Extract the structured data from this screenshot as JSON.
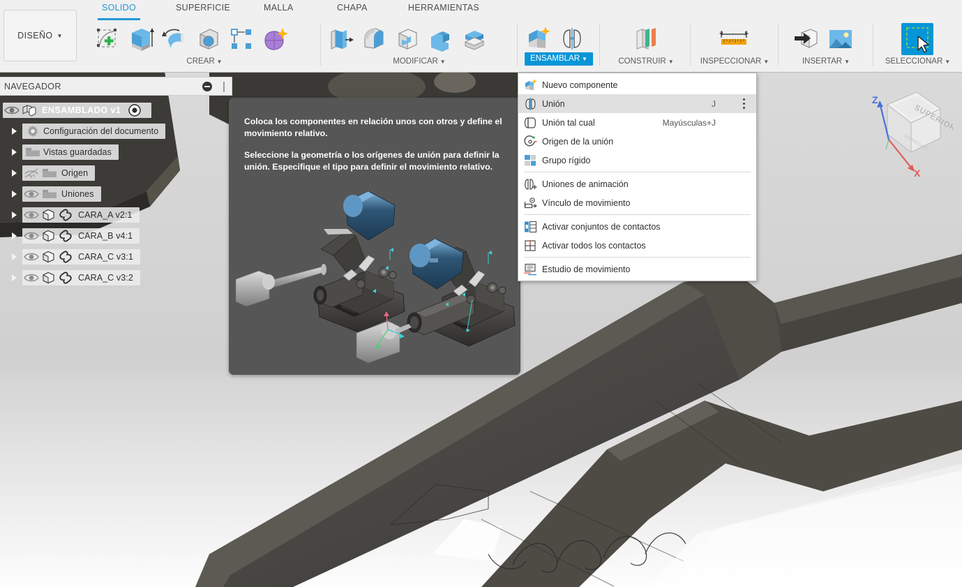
{
  "app": {
    "workspace_label": "DISEÑO",
    "caret": "▼"
  },
  "tabs": [
    {
      "label": "SOLIDO",
      "active": true
    },
    {
      "label": "SUPERFICIE",
      "active": false
    },
    {
      "label": "MALLA",
      "active": false
    },
    {
      "label": "CHAPA",
      "active": false
    },
    {
      "label": "HERRAMIENTAS",
      "active": false
    }
  ],
  "ribbon_groups": [
    {
      "label": "CREAR",
      "highlighted": false
    },
    {
      "label": "MODIFICAR",
      "highlighted": false
    },
    {
      "label": "ENSAMBLAR",
      "highlighted": true
    },
    {
      "label": "CONSTRUIR",
      "highlighted": false
    },
    {
      "label": "INSPECCIONAR",
      "highlighted": false
    },
    {
      "label": "INSERTAR",
      "highlighted": false
    },
    {
      "label": "SELECCIONAR",
      "highlighted": false
    }
  ],
  "navigator": {
    "title": "NAVEGADOR",
    "collapse_icon": "minus-circle-icon",
    "items": [
      {
        "label": "ENSAMBLADO v1",
        "selected": true,
        "arrow": false,
        "eye": "eye-visible-icon",
        "icon": "assembly-icon",
        "radio": true
      },
      {
        "label": "Configuración del documento",
        "selected": false,
        "arrow": true,
        "eye": "none",
        "icon": "gear-icon"
      },
      {
        "label": "Vistas guardadas",
        "selected": false,
        "arrow": true,
        "eye": "none",
        "icon": "folder-icon"
      },
      {
        "label": "Origen",
        "selected": false,
        "arrow": true,
        "eye": "eye-hidden-icon",
        "icon": "folder-icon"
      },
      {
        "label": "Uniones",
        "selected": false,
        "arrow": true,
        "eye": "eye-visible-icon",
        "icon": "folder-icon"
      },
      {
        "label": "CARA_A v2:1",
        "selected": false,
        "arrow": true,
        "eye": "eye-visible-icon",
        "icon": "component-icon",
        "link": true
      },
      {
        "label": "CARA_B v4:1",
        "selected": false,
        "arrow": true,
        "eye": "eye-visible-icon",
        "icon": "component-icon",
        "link": true
      },
      {
        "label": "CARA_C v3:1",
        "selected": false,
        "arrow": true,
        "eye": "eye-visible-icon",
        "icon": "component-icon",
        "link": true
      },
      {
        "label": "CARA_C v3:2",
        "selected": false,
        "arrow": true,
        "eye": "eye-visible-icon",
        "icon": "component-icon",
        "link": true
      }
    ]
  },
  "menu": {
    "owner": "ENSAMBLAR",
    "items": [
      {
        "type": "item",
        "label": "Nuevo componente",
        "shortcut": "",
        "icon": "new-component-icon",
        "highlighted": false,
        "overflow": false
      },
      {
        "type": "item",
        "label": "Unión",
        "shortcut": "J",
        "icon": "joint-icon",
        "highlighted": true,
        "overflow": true
      },
      {
        "type": "item",
        "label": "Unión tal cual",
        "shortcut": "Mayúsculas+J",
        "icon": "as-built-joint-icon",
        "highlighted": false,
        "overflow": false
      },
      {
        "type": "item",
        "label": "Origen de la unión",
        "shortcut": "",
        "icon": "joint-origin-icon",
        "highlighted": false,
        "overflow": false
      },
      {
        "type": "item",
        "label": "Grupo rígido",
        "shortcut": "",
        "icon": "rigid-group-icon",
        "highlighted": false,
        "overflow": false
      },
      {
        "type": "separator"
      },
      {
        "type": "item",
        "label": "Uniones de animación",
        "shortcut": "",
        "icon": "animate-joints-icon",
        "highlighted": false,
        "overflow": false
      },
      {
        "type": "item",
        "label": "Vínculo de movimiento",
        "shortcut": "",
        "icon": "motion-link-icon",
        "highlighted": false,
        "overflow": false
      },
      {
        "type": "separator"
      },
      {
        "type": "item",
        "label": "Activar conjuntos de contactos",
        "shortcut": "",
        "icon": "enable-contact-sets-icon",
        "highlighted": false,
        "overflow": false
      },
      {
        "type": "item",
        "label": "Activar todos los contactos",
        "shortcut": "",
        "icon": "enable-all-contact-icon",
        "highlighted": false,
        "overflow": false
      },
      {
        "type": "separator"
      },
      {
        "type": "item",
        "label": "Estudio de movimiento",
        "shortcut": "",
        "icon": "motion-study-icon",
        "highlighted": false,
        "overflow": false
      }
    ]
  },
  "tooltip": {
    "paragraph1": "Coloca los componentes en relación unos con otros y define el movimiento relativo.",
    "paragraph2": "Seleccione la geometría o los orígenes de unión para definir la unión. Especifique el tipo para definir el movimiento relativo.",
    "illustration": "exploded-toggle-clamp-assembly"
  },
  "viewcube": {
    "face_label": "SUPERIOR",
    "axis_z": "Z",
    "axis_x": "X"
  },
  "colors": {
    "accent_blue": "#0696d7",
    "tab_active": "#2196d4",
    "ribbon_bg": "#f0f0f0",
    "tooltip_bg": "#565656",
    "viewport_bg": "#d3d3d3",
    "model_dark": "#4a4a47"
  }
}
